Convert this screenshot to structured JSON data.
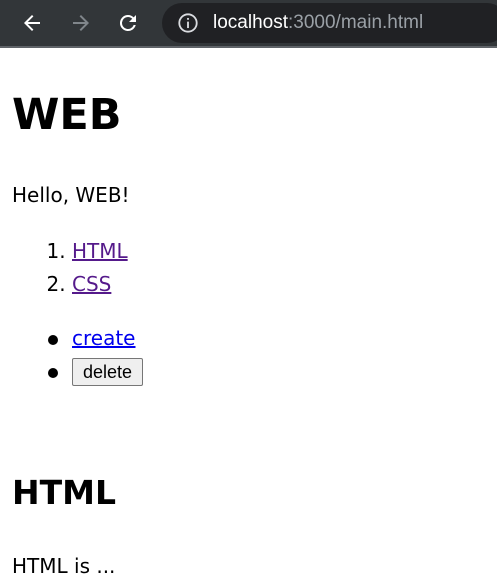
{
  "browser": {
    "url_host": "localhost",
    "url_rest": ":3000/main.html",
    "icons": {
      "back": "arrow-left-icon",
      "forward": "arrow-right-icon",
      "reload": "reload-icon",
      "info": "info-icon"
    }
  },
  "page": {
    "title": "WEB",
    "intro": "Hello, WEB!",
    "topics": [
      {
        "label": "HTML"
      },
      {
        "label": "CSS"
      }
    ],
    "controls": {
      "create_label": "create",
      "delete_label": "delete"
    },
    "section": {
      "heading": "HTML",
      "body": "HTML is ..."
    }
  }
}
